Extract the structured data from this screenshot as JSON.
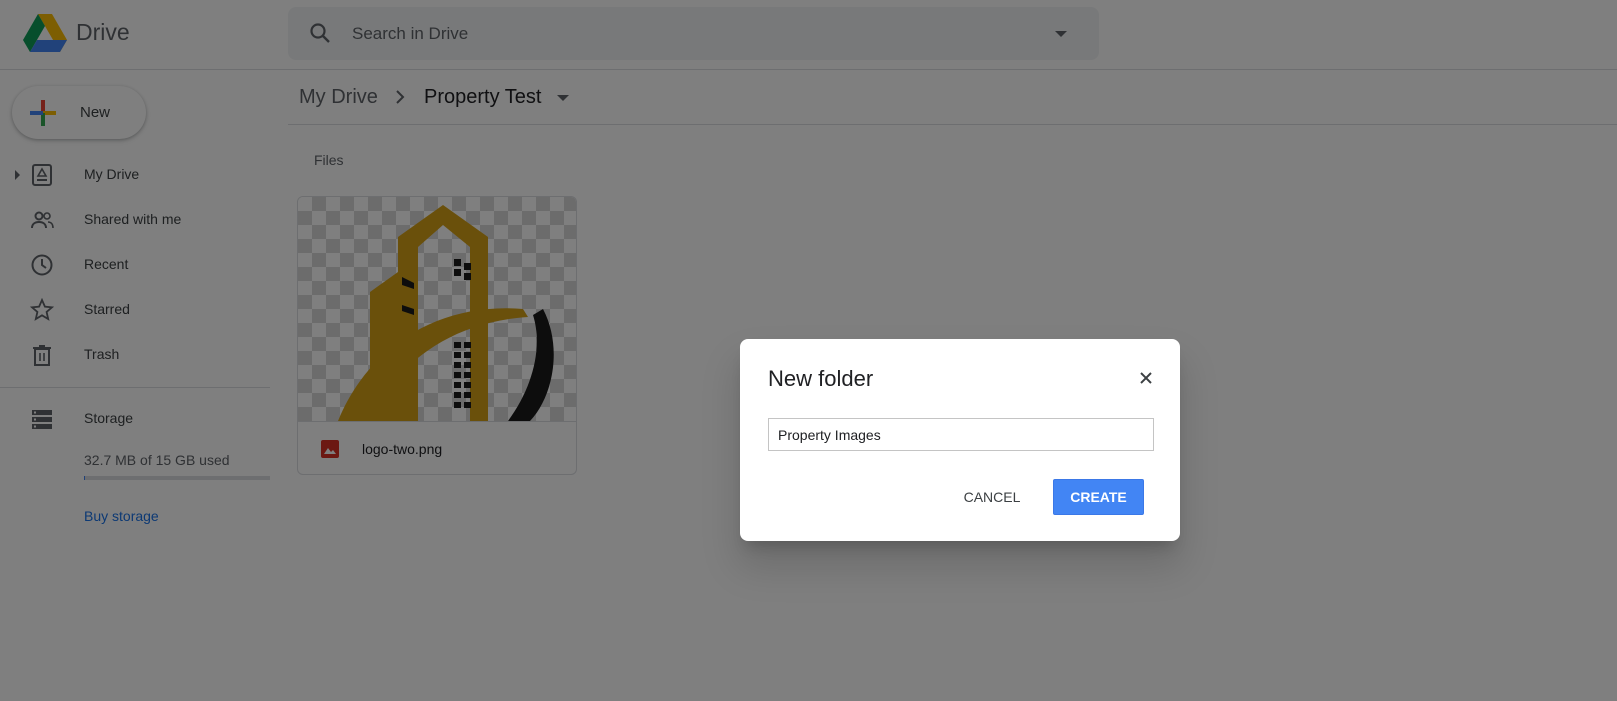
{
  "app": {
    "brand": "Drive"
  },
  "search": {
    "placeholder": "Search in Drive",
    "icon": "search-icon"
  },
  "sidebar": {
    "new_label": "New",
    "items": [
      {
        "label": "My Drive",
        "icon": "my-drive-icon"
      },
      {
        "label": "Shared with me",
        "icon": "people-icon"
      },
      {
        "label": "Recent",
        "icon": "clock-icon"
      },
      {
        "label": "Starred",
        "icon": "star-icon"
      },
      {
        "label": "Trash",
        "icon": "trash-icon"
      }
    ],
    "storage": {
      "label": "Storage",
      "used_text": "32.7 MB of 15 GB used",
      "used_fraction": 0.002,
      "buy_label": "Buy storage"
    }
  },
  "breadcrumb": {
    "root": "My Drive",
    "current": "Property Test"
  },
  "main": {
    "section_title": "Files",
    "files": [
      {
        "name": "logo-two.png",
        "type_icon": "image-file-icon"
      }
    ]
  },
  "dialog": {
    "title": "New folder",
    "input_value": "Property Images",
    "cancel_label": "CANCEL",
    "create_label": "CREATE"
  },
  "colors": {
    "accent": "#4285f4",
    "link": "#1a73e8",
    "scrim": "rgba(0,0,0,0.5)"
  }
}
